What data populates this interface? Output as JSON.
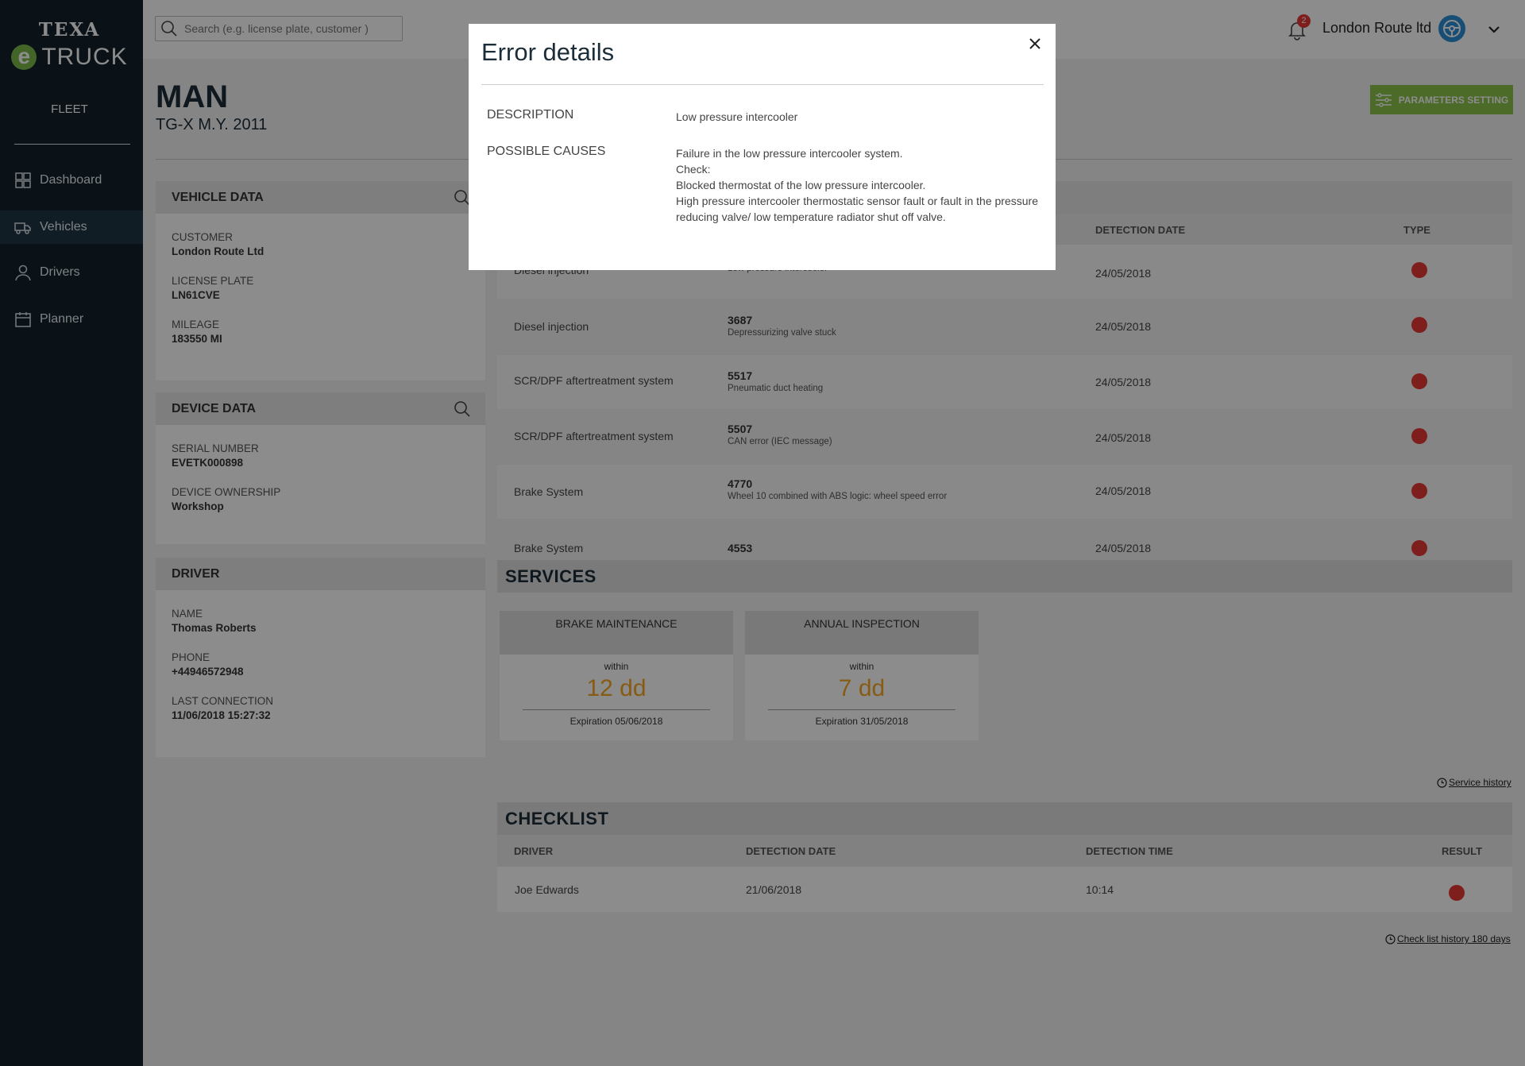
{
  "brand": {
    "top": "TEXA",
    "e": "e",
    "truck": "TRUCK",
    "section": "FLEET"
  },
  "nav": [
    {
      "label": "Dashboard",
      "icon": "dashboard-icon"
    },
    {
      "label": "Vehicles",
      "icon": "truck-icon"
    },
    {
      "label": "Drivers",
      "icon": "user-icon"
    },
    {
      "label": "Planner",
      "icon": "calendar-icon"
    }
  ],
  "topbar": {
    "search_placeholder": "Search (e.g. license plate, customer )",
    "notifications": "2",
    "company": "London Route ltd"
  },
  "vehicle": {
    "make": "MAN",
    "model": "TG-X  M.Y. 2011"
  },
  "params_button": "PARAMETERS SETTING",
  "vehicle_data": {
    "title": "VEHICLE DATA",
    "customer_label": "CUSTOMER",
    "customer": "London Route Ltd",
    "plate_label": "LICENSE PLATE",
    "plate": "LN61CVE",
    "mileage_label": "MILEAGE",
    "mileage": "183550 MI"
  },
  "device_data": {
    "title": "DEVICE DATA",
    "serial_label": "SERIAL NUMBER",
    "serial": "EVETK000898",
    "ownership_label": "DEVICE OWNERSHIP",
    "ownership": "Workshop"
  },
  "driver": {
    "title": "DRIVER",
    "name_label": "NAME",
    "name": "Thomas Roberts",
    "phone_label": "PHONE",
    "phone": "+44946572948",
    "last_label": "LAST CONNECTION",
    "last": "11/06/2018 15:27:32"
  },
  "errors": {
    "columns": {
      "date": "DETECTION DATE",
      "type": "TYPE"
    },
    "rows": [
      {
        "system": "Diesel injection",
        "code": "",
        "desc": "Low pressure intercooler",
        "date": "24/05/2018"
      },
      {
        "system": "Diesel injection",
        "code": "3687",
        "desc": "Depressurizing valve stuck",
        "date": "24/05/2018"
      },
      {
        "system": "SCR/DPF aftertreatment system",
        "code": "5517",
        "desc": "Pneumatic duct heating",
        "date": "24/05/2018"
      },
      {
        "system": "SCR/DPF aftertreatment system",
        "code": "5507",
        "desc": "CAN error (IEC message)",
        "date": "24/05/2018"
      },
      {
        "system": "Brake System",
        "code": "4770",
        "desc": "Wheel 10 combined with ABS logic: wheel speed error",
        "date": "24/05/2018"
      },
      {
        "system": "Brake System",
        "code": "4553",
        "desc": "",
        "date": "24/05/2018"
      }
    ]
  },
  "services": {
    "title": "SERVICES",
    "cards": [
      {
        "name": "BRAKE MAINTENANCE",
        "within": "within",
        "value": "12 dd",
        "expiration": "Expiration 05/06/2018"
      },
      {
        "name": "ANNUAL INSPECTION",
        "within": "within",
        "value": "7 dd",
        "expiration": "Expiration 31/05/2018"
      }
    ],
    "history_link": "Service history"
  },
  "checklist": {
    "title": "CHECKLIST",
    "columns": {
      "driver": "DRIVER",
      "date": "DETECTION DATE",
      "time": "DETECTION TIME",
      "result": "RESULT"
    },
    "row": {
      "driver": "Joe Edwards",
      "date": "21/06/2018",
      "time": "10:14"
    },
    "history_link": "Check list history 180 days"
  },
  "modal": {
    "title": "Error details",
    "desc_label": "DESCRIPTION",
    "desc": "Low pressure intercooler",
    "causes_label": "POSSIBLE CAUSES",
    "causes": [
      "Failure in the low pressure intercooler system.",
      "Check:",
      "Blocked thermostat of the low pressure intercooler.",
      "High pressure intercooler thermostatic sensor fault or fault in the pressure",
      "reducing valve/ low temperature radiator shut off valve."
    ]
  },
  "colors": {
    "sidebar": "#13212b",
    "accent_green": "#8bc34a",
    "error_red": "#e53935",
    "service_orange": "#f5a623"
  }
}
